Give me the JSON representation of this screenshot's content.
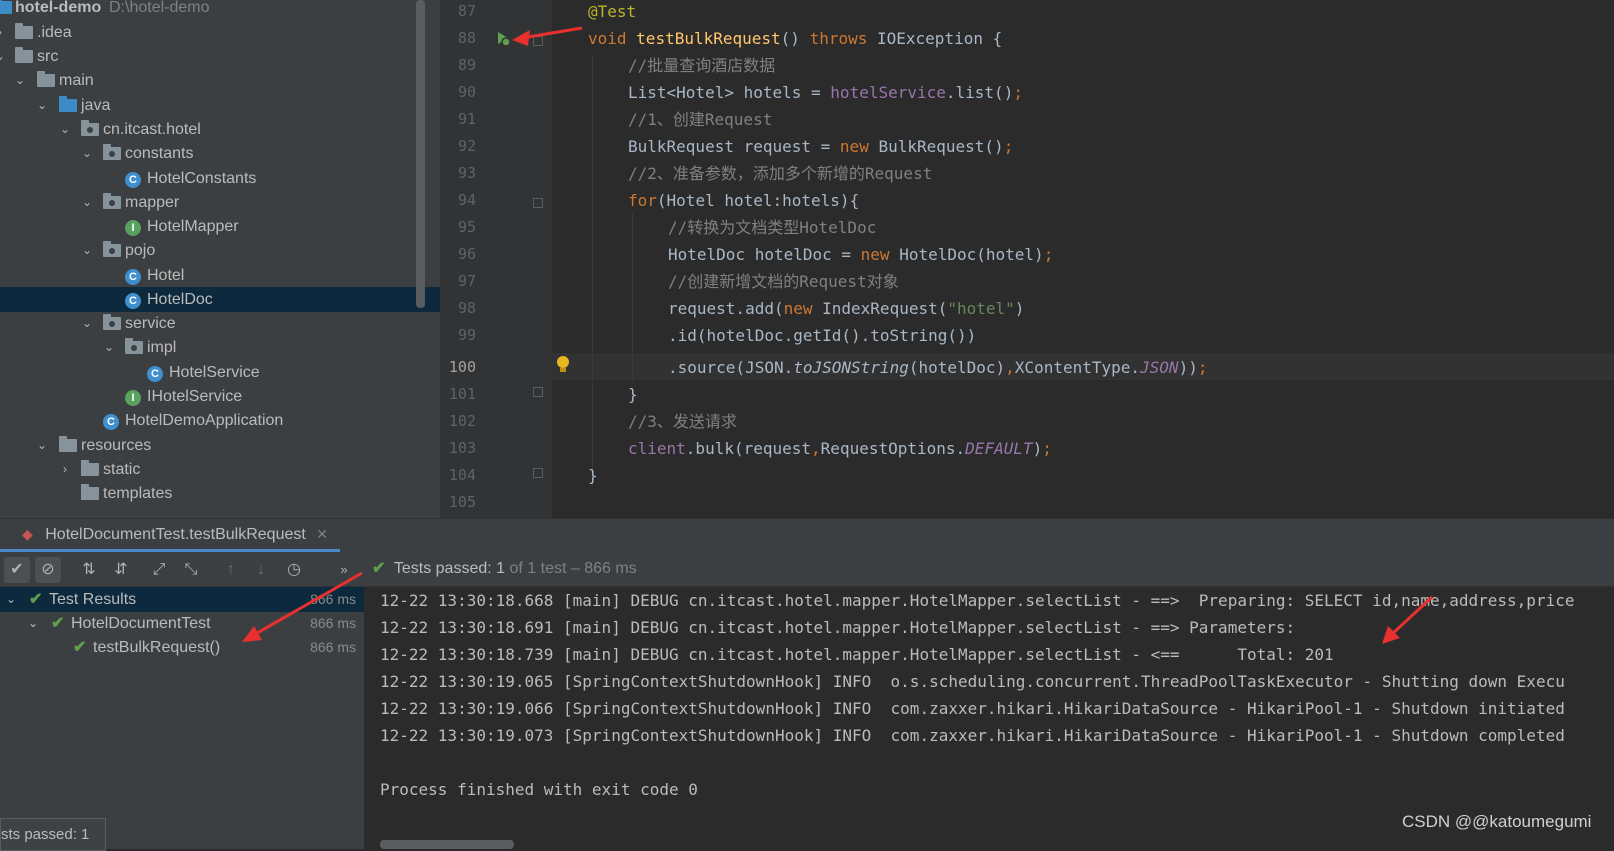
{
  "project_tree": {
    "root_name": "hotel-demo",
    "root_path": "D:\\hotel-demo",
    "items": [
      {
        "label": ".idea",
        "icon": "folder-icon"
      },
      {
        "label": "src",
        "icon": "folder-icon"
      },
      {
        "label": "main",
        "icon": "folder-icon"
      },
      {
        "label": "java",
        "icon": "source-folder-icon"
      },
      {
        "label": "cn.itcast.hotel",
        "icon": "package-icon"
      },
      {
        "label": "constants",
        "icon": "package-icon"
      },
      {
        "label": "HotelConstants",
        "icon": "class-icon",
        "badge": "C"
      },
      {
        "label": "mapper",
        "icon": "package-icon"
      },
      {
        "label": "HotelMapper",
        "icon": "interface-icon",
        "badge": "I"
      },
      {
        "label": "pojo",
        "icon": "package-icon"
      },
      {
        "label": "Hotel",
        "icon": "class-icon",
        "badge": "C"
      },
      {
        "label": "HotelDoc",
        "icon": "class-icon",
        "badge": "C"
      },
      {
        "label": "service",
        "icon": "package-icon"
      },
      {
        "label": "impl",
        "icon": "package-icon"
      },
      {
        "label": "HotelService",
        "icon": "class-icon",
        "badge": "C"
      },
      {
        "label": "IHotelService",
        "icon": "interface-icon",
        "badge": "I"
      },
      {
        "label": "HotelDemoApplication",
        "icon": "spring-boot-class-icon",
        "badge": "C"
      },
      {
        "label": "resources",
        "icon": "resources-folder-icon"
      },
      {
        "label": "static",
        "icon": "folder-icon"
      },
      {
        "label": "templates",
        "icon": "folder-icon"
      }
    ]
  },
  "editor": {
    "line_numbers": [
      "87",
      "88",
      "89",
      "90",
      "91",
      "92",
      "93",
      "94",
      "95",
      "96",
      "97",
      "98",
      "99",
      "100",
      "101",
      "102",
      "103",
      "104",
      "105"
    ],
    "current_line": "100",
    "code": {
      "l87": {
        "ann": "@Test"
      },
      "l88": {
        "kw1": "void",
        "method": "testBulkRequest",
        "p": "() ",
        "kw2": "throws",
        "rest": " IOException {"
      },
      "l89": {
        "comment": "//批量查询酒店数据"
      },
      "l90": {
        "a": "List<Hotel> hotels = ",
        "field": "hotelService",
        "b": ".list()",
        "semi": ";"
      },
      "l91": {
        "comment": "//1、创建Request"
      },
      "l92": {
        "a": "BulkRequest request = ",
        "kw": "new",
        "b": " BulkRequest()",
        "semi": ";"
      },
      "l93": {
        "comment": "//2、准备参数，添加多个新增的Request"
      },
      "l94": {
        "kw": "for",
        "rest": "(Hotel hotel:hotels){"
      },
      "l95": {
        "comment": "//转换为文档类型HotelDoc"
      },
      "l96": {
        "a": "HotelDoc hotelDoc = ",
        "kw": "new",
        "b": " HotelDoc(hotel)",
        "semi": ";"
      },
      "l97": {
        "comment": "//创建新增文档的Request对象"
      },
      "l98": {
        "a": "request.add(",
        "kw": "new",
        "b": " IndexRequest(",
        "str": "\"hotel\"",
        "c": ")"
      },
      "l99": {
        "a": ".id(hotelDoc.getId().toString())"
      },
      "l100": {
        "a": ".source(JSON.",
        "static_method": "toJSONString",
        "b": "(hotelDoc)",
        "comma": ",",
        "c": "XContentType.",
        "const": "JSON",
        "d": "))",
        "semi": ";"
      },
      "l101": {
        "a": "}"
      },
      "l102": {
        "comment": "//3、发送请求"
      },
      "l103": {
        "field": "client",
        "a": ".bulk(request",
        "comma": ",",
        "b": "RequestOptions.",
        "const": "DEFAULT",
        "c": ")",
        "semi": ";"
      },
      "l104": {
        "a": "}"
      }
    }
  },
  "run_panel": {
    "tab_title": "HotelDocumentTest.testBulkRequest",
    "status": {
      "prefix": "Tests passed: ",
      "count": "1",
      "suffix": " of 1 test – 866 ms"
    },
    "tests": [
      {
        "label": "Test Results",
        "time": "866 ms"
      },
      {
        "label": "HotelDocumentTest",
        "time": "866 ms"
      },
      {
        "label": "testBulkRequest()",
        "time": "866 ms"
      }
    ],
    "console_lines": [
      "12-22 13:30:18.668 [main] DEBUG cn.itcast.hotel.mapper.HotelMapper.selectList - ==>  Preparing: SELECT id,name,address,price",
      "12-22 13:30:18.691 [main] DEBUG cn.itcast.hotel.mapper.HotelMapper.selectList - ==> Parameters: ",
      "12-22 13:30:18.739 [main] DEBUG cn.itcast.hotel.mapper.HotelMapper.selectList - <==      Total: 201",
      "12-22 13:30:19.065 [SpringContextShutdownHook] INFO  o.s.scheduling.concurrent.ThreadPoolTaskExecutor - Shutting down Execu",
      "12-22 13:30:19.066 [SpringContextShutdownHook] INFO  com.zaxxer.hikari.HikariDataSource - HikariPool-1 - Shutdown initiated",
      "12-22 13:30:19.073 [SpringContextShutdownHook] INFO  com.zaxxer.hikari.HikariDataSource - HikariPool-1 - Shutdown completed",
      "",
      "Process finished with exit code 0"
    ],
    "status_popup": "sts passed: 1"
  },
  "watermark": "CSDN @@katoumegumi",
  "colors": {
    "accent": "#4a88c7",
    "pass": "#5ea04f",
    "arrow": "#e8312f"
  }
}
